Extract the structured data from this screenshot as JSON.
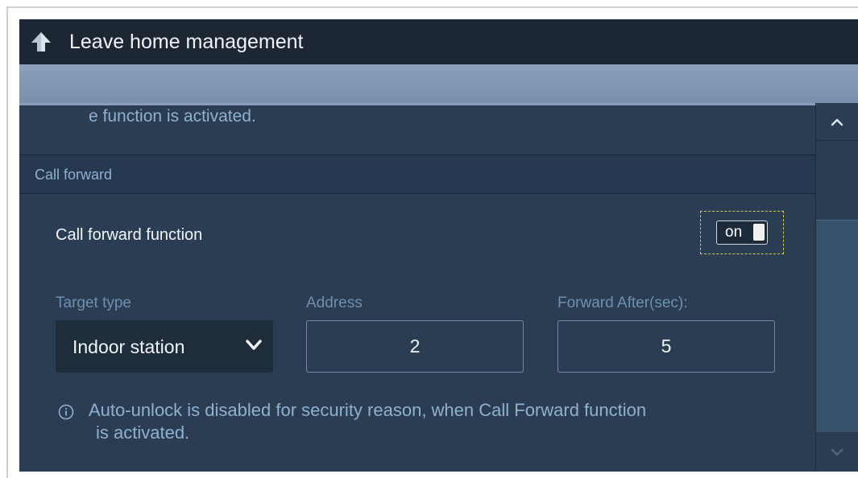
{
  "header": {
    "title": "Leave home management"
  },
  "content": {
    "truncated_text": "e function is activated.",
    "section_title": "Call forward",
    "call_forward_label": "Call forward function",
    "toggle_value": "on",
    "target_type_label": "Target type",
    "target_type_value": "Indoor station",
    "address_label": "Address",
    "address_value": "2",
    "forward_after_label": "Forward After(sec):",
    "forward_after_value": "5",
    "info_line1": "Auto-unlock is disabled for security reason, when Call Forward function",
    "info_line2": "is activated."
  },
  "icons": {
    "back": "back-arrow-icon",
    "dropdown": "chevron-down-icon",
    "info": "info-icon",
    "scroll_up": "chevron-up-icon",
    "scroll_down": "chevron-down-icon"
  },
  "colors": {
    "background": "#2a3d52",
    "titlebar": "#1d2633",
    "accent_bar": "#8a9fbb",
    "secondary_text": "#8fb1cf",
    "focus_outline": "#d8c84a"
  }
}
